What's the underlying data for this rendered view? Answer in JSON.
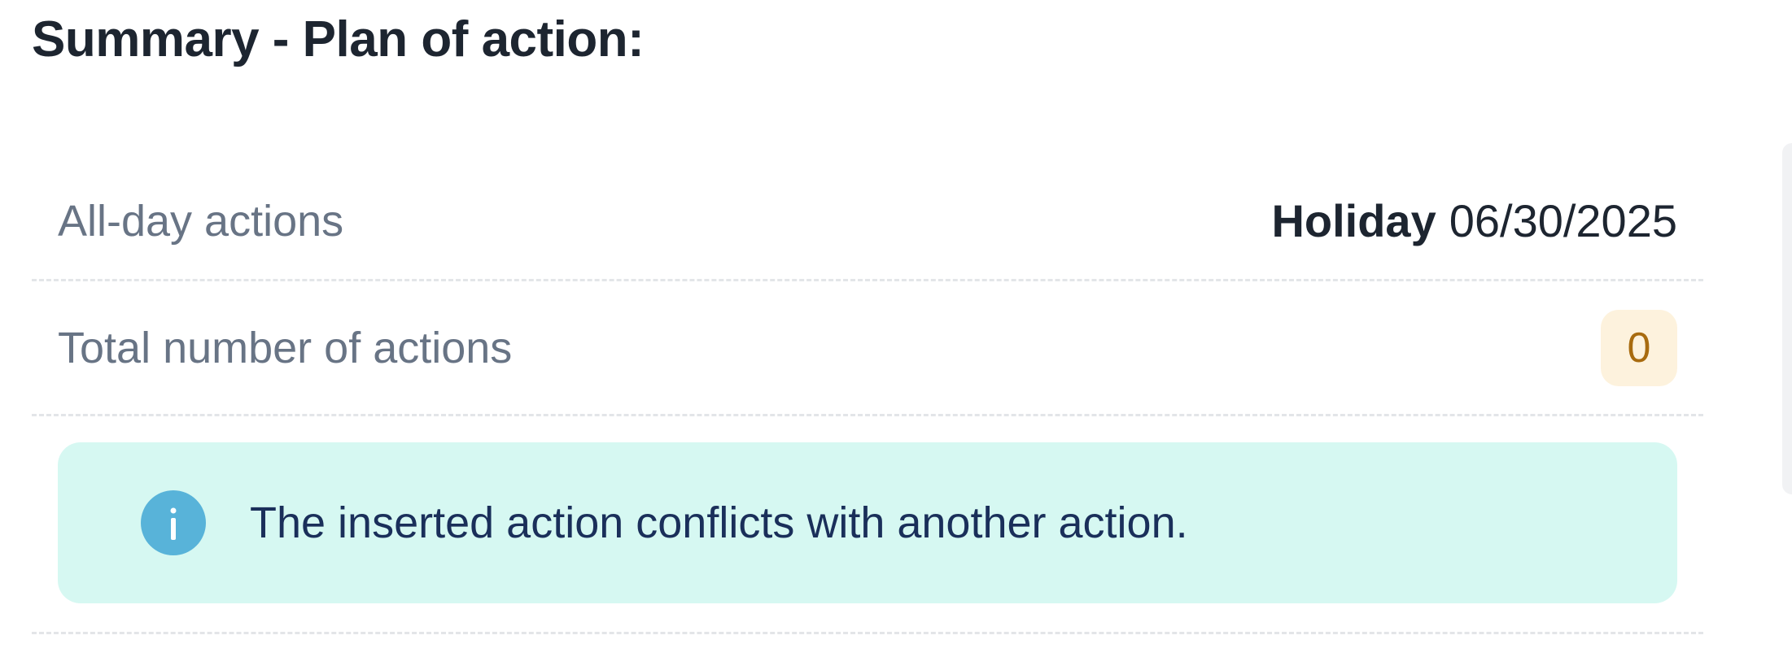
{
  "page": {
    "title": "Summary - Plan of action:"
  },
  "summary": {
    "all_day": {
      "label": "All-day actions",
      "value_strong": "Holiday",
      "value": "06/30/2025"
    },
    "total": {
      "label": "Total number of actions",
      "count": "0"
    },
    "alert": {
      "icon": "info-icon",
      "text": "The inserted action conflicts with another action."
    }
  },
  "colors": {
    "title": "#1d2530",
    "label": "#687485",
    "badge_bg": "#fdf2dd",
    "badge_text": "#a86b0f",
    "alert_bg": "#d6f8f2",
    "alert_text": "#1a2f5a",
    "info_icon": "#58b3d9"
  }
}
